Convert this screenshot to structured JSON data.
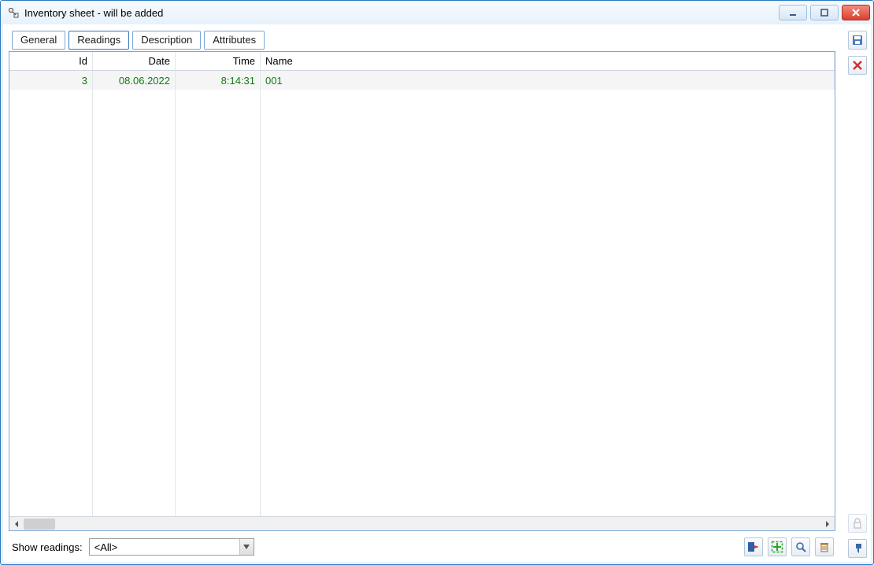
{
  "window": {
    "title": "Inventory sheet - will be added"
  },
  "tabs": [
    {
      "label": "General"
    },
    {
      "label": "Readings"
    },
    {
      "label": "Description"
    },
    {
      "label": "Attributes"
    }
  ],
  "active_tab_index": 1,
  "grid": {
    "columns": {
      "id": "Id",
      "date": "Date",
      "time": "Time",
      "name": "Name"
    },
    "rows": [
      {
        "id": "3",
        "date": "08.06.2022",
        "time": "8:14:31",
        "name": "001"
      }
    ]
  },
  "footer": {
    "label": "Show readings:",
    "combo_value": "<All>"
  }
}
